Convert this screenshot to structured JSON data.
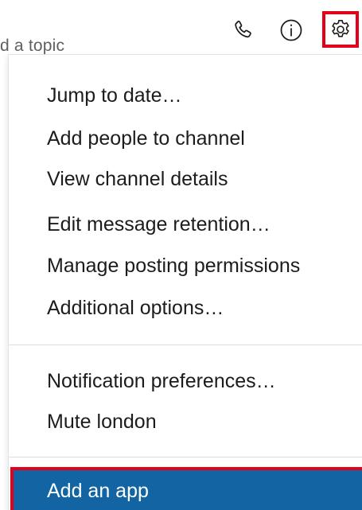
{
  "header": {
    "topic_text": "d a topic",
    "icons": {
      "phone": "phone-icon",
      "info": "info-icon",
      "settings": "gear-icon"
    }
  },
  "menu": {
    "items": [
      {
        "label": "Jump to date…"
      },
      {
        "label": "Add people to channel"
      },
      {
        "label": "View channel details"
      },
      {
        "label": "Edit message retention…"
      },
      {
        "label": "Manage posting permissions"
      },
      {
        "label": "Additional options…"
      }
    ],
    "notification_items": [
      {
        "label": "Notification preferences…"
      },
      {
        "label": "Mute london"
      }
    ],
    "highlighted_item": {
      "label": "Add an app"
    }
  },
  "colors": {
    "highlight_bg": "#1264a3",
    "annotation_border": "#e3001b",
    "text": "#1d1c1d"
  }
}
